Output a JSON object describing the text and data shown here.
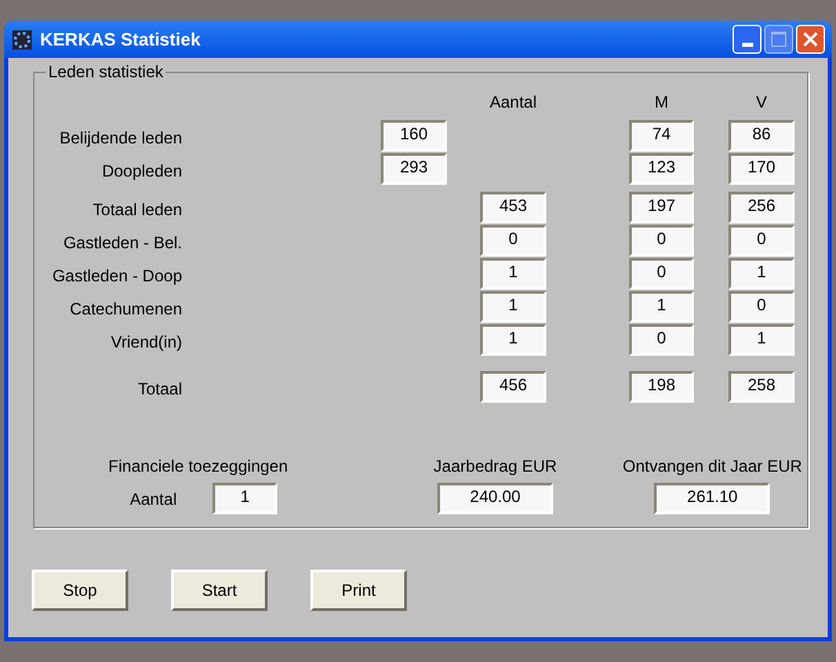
{
  "window": {
    "title": "KERKAS Statistiek",
    "maximize_disabled": true
  },
  "group": {
    "title": "Leden statistiek"
  },
  "columns": [
    "Aantal",
    "M",
    "V"
  ],
  "rows": [
    {
      "label": "Belijdende leden",
      "kind": "part",
      "part": "160",
      "m": "74",
      "v": "86"
    },
    {
      "label": "Doopleden",
      "kind": "part",
      "part": "293",
      "m": "123",
      "v": "170"
    },
    {
      "label": "Totaal leden",
      "kind": "count",
      "aantal": "453",
      "m": "197",
      "v": "256"
    },
    {
      "label": "Gastleden - Bel.",
      "kind": "count",
      "aantal": "0",
      "m": "0",
      "v": "0"
    },
    {
      "label": "Gastleden - Doop",
      "kind": "count",
      "aantal": "1",
      "m": "0",
      "v": "1"
    },
    {
      "label": "Catechumenen",
      "kind": "count",
      "aantal": "1",
      "m": "1",
      "v": "0"
    },
    {
      "label": "Vriend(in)",
      "kind": "count",
      "aantal": "1",
      "m": "0",
      "v": "1"
    },
    {
      "label": "Totaal",
      "kind": "total",
      "aantal": "456",
      "m": "198",
      "v": "258"
    }
  ],
  "finance": {
    "title": "Financiele toezeggingen",
    "count_label": "Aantal",
    "count": "1",
    "yearly_label": "Jaarbedrag EUR",
    "yearly": "240.00",
    "received_label": "Ontvangen dit Jaar EUR",
    "received": "261.10"
  },
  "buttons": [
    "Stop",
    "Start",
    "Print"
  ]
}
